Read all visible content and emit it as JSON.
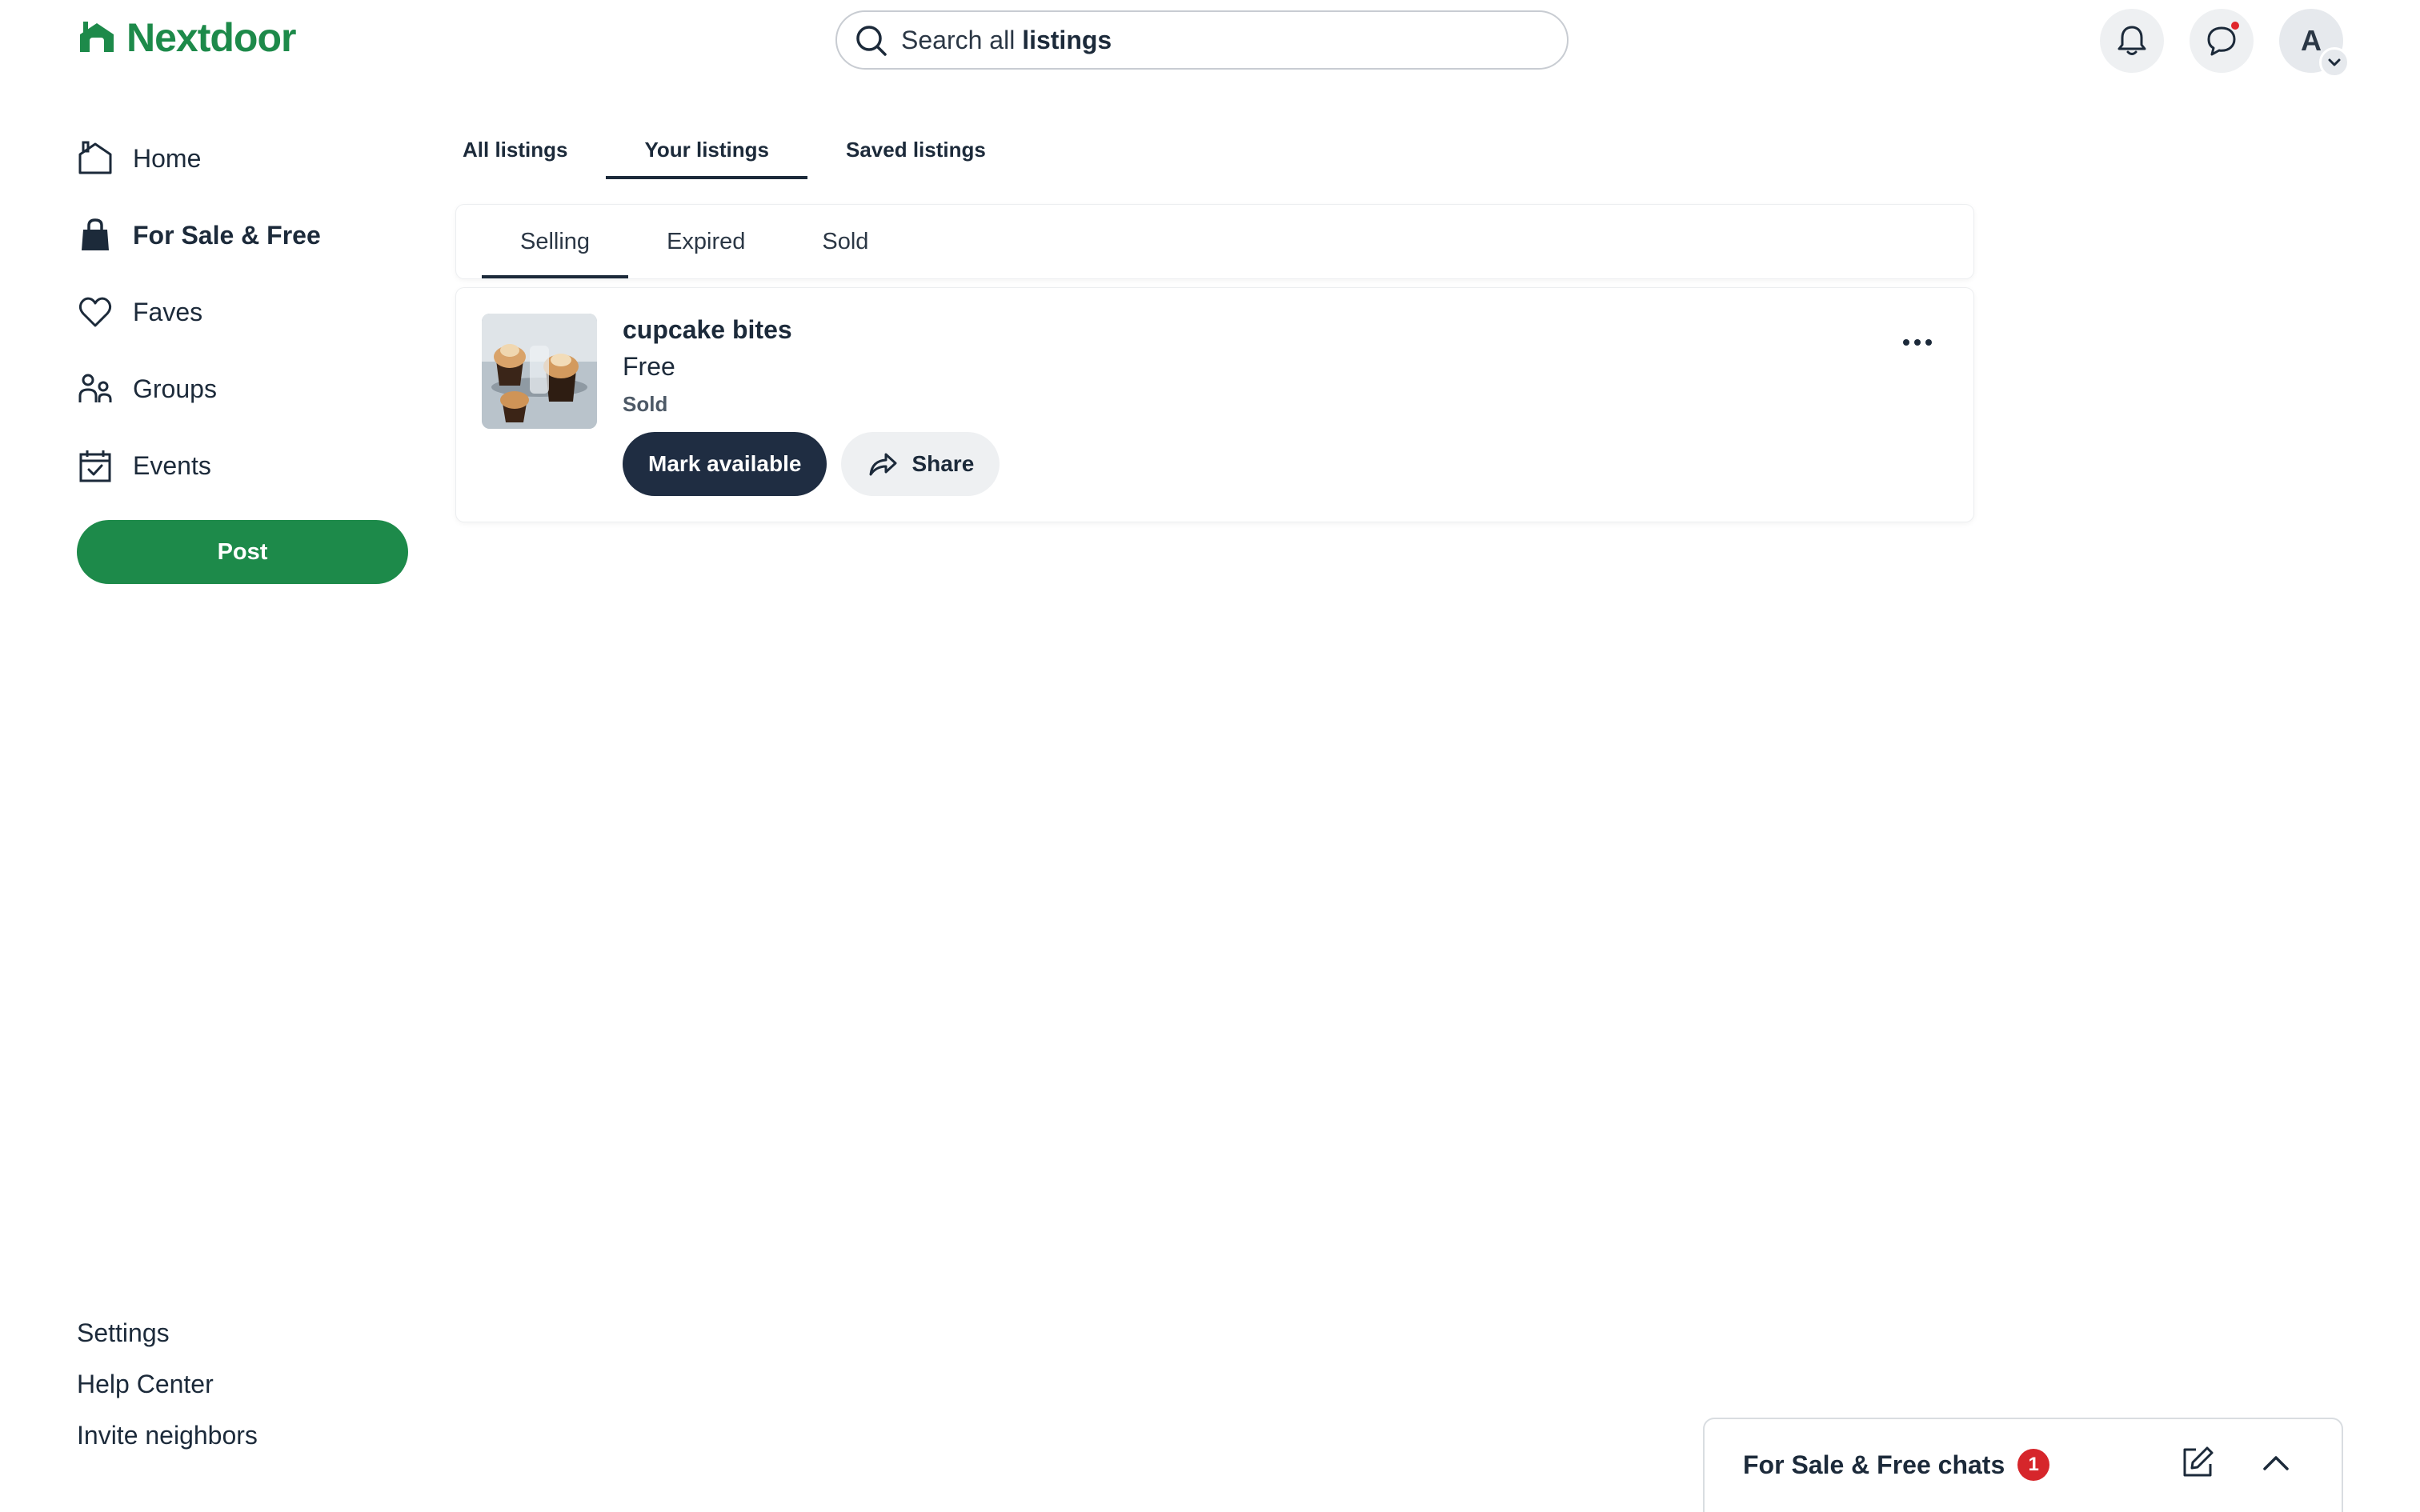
{
  "brand": {
    "name": "Nextdoor",
    "color": "#1d8a4a"
  },
  "search": {
    "prefix": "Search all",
    "bold": "listings"
  },
  "header": {
    "notifications_icon": "bell-icon",
    "chat_icon": "chat-icon",
    "avatar_initial": "A"
  },
  "sidebar": {
    "items": [
      {
        "label": "Home",
        "icon": "home-icon"
      },
      {
        "label": "For Sale & Free",
        "icon": "shopping-bag-icon"
      },
      {
        "label": "Faves",
        "icon": "heart-icon"
      },
      {
        "label": "Groups",
        "icon": "groups-icon"
      },
      {
        "label": "Events",
        "icon": "calendar-icon"
      }
    ],
    "post_label": "Post"
  },
  "footer": {
    "links": [
      "Settings",
      "Help Center",
      "Invite neighbors"
    ]
  },
  "main": {
    "tabs": [
      "All listings",
      "Your listings",
      "Saved listings"
    ],
    "active_tab": "Your listings",
    "subtabs": [
      "Selling",
      "Expired",
      "Sold"
    ],
    "active_subtab": "Selling"
  },
  "listing": {
    "title": "cupcake bites",
    "price": "Free",
    "status": "Sold",
    "primary_action": "Mark available",
    "secondary_action": "Share"
  },
  "chats": {
    "title": "For Sale & Free chats",
    "unread": "1"
  }
}
